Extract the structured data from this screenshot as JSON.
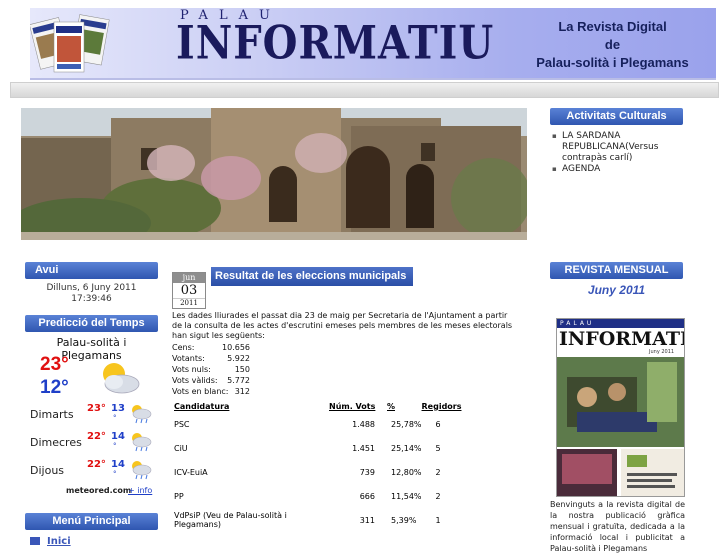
{
  "header": {
    "palau": "PALAU",
    "title": "INFORMATIU",
    "tagline": [
      "La Revista Digital",
      "de",
      "Palau-solità i Plegamans"
    ],
    "magazine_cover_text": "INFORMATIU"
  },
  "right_col": {
    "activities_title": "Activitats Culturals",
    "activities": [
      "LA SARDANA REPUBLICANA(Versus contrapàs carlí)",
      "AGENDA"
    ],
    "revista_title": "REVISTA MENSUAL",
    "revista_month": "Juny 2011",
    "cover_palau": "PALAU",
    "cover_title": "INFORMATIU",
    "cover_issue": "Juny 2011",
    "welcome_text": "Benvinguts a la revista digital de la nostra publicació gràfica mensual i gratuïta, dedicada a la informació local i publicitat a Palau-solità i Plegamans"
  },
  "left_col": {
    "avui_title": "Avui",
    "date": "Dilluns, 6 Juny 2011",
    "time": "17:39:46",
    "weather_title": "Predicció del Temps",
    "town": "Palau-solità i Plegamans",
    "temp_max": "23°",
    "temp_min": "12°",
    "forecast": [
      {
        "day": "Dimarts",
        "max": "23°",
        "min": "13",
        "icon": "partly-cloudy-rain-icon"
      },
      {
        "day": "Dimecres",
        "max": "22°",
        "min": "14",
        "icon": "partly-cloudy-rain-icon"
      },
      {
        "day": "Dijous",
        "max": "22°",
        "min": "14",
        "icon": "partly-cloudy-rain-icon"
      }
    ],
    "meteored": "meteored.com",
    "info_link": "+ info",
    "menu_title": "Menú Principal",
    "menu_first": "Inici"
  },
  "article": {
    "month": "jun",
    "day": "03",
    "year": "2011",
    "title": "Resultat de les eleccions municipals",
    "intro": "Les dades lliurades el passat dia 23 de maig per Secretaria de l'Ajuntament a partir de la consulta de les actes d'escrutini emeses pels membres de les meses electorals han sigut les següents:",
    "stats": [
      {
        "label": "Cens:",
        "value": "10.656"
      },
      {
        "label": "Votants:",
        "value": "5.922"
      },
      {
        "label": "Vots nuls:",
        "value": "150"
      },
      {
        "label": "Vots vàlids:",
        "value": "5.772"
      },
      {
        "label": "Vots en blanc:",
        "value": "312"
      }
    ],
    "table_headers": [
      "Candidatura",
      "Núm. Vots",
      "%",
      "Regidors"
    ],
    "rows": [
      [
        "PSC",
        "1.488",
        "25,78%",
        "6"
      ],
      [
        "CiU",
        "1.451",
        "25,14%",
        "5"
      ],
      [
        "ICV-EuiA",
        "739",
        "12,80%",
        "2"
      ],
      [
        "PP",
        "666",
        "11,54%",
        "2"
      ],
      [
        "VdPsiP (Veu de Palau-solità i Plegamans)",
        "311",
        "5,39%",
        "1"
      ]
    ]
  }
}
